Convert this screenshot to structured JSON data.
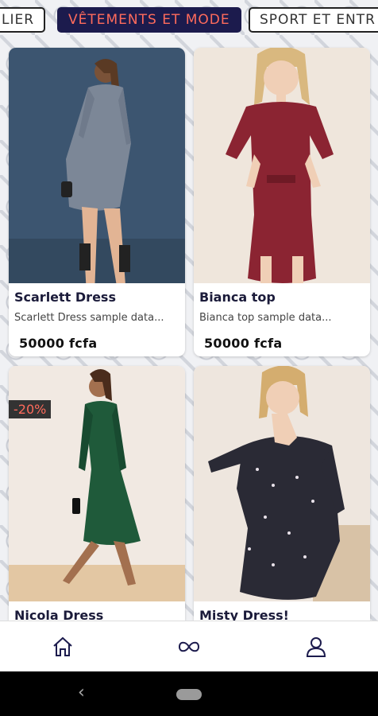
{
  "categories": [
    {
      "label": "LIER",
      "active": false
    },
    {
      "label": "VÊTEMENTS ET MODE",
      "active": true
    },
    {
      "label": "SPORT ET ENTR",
      "active": false
    }
  ],
  "products": [
    {
      "name": "Scarlett Dress",
      "description": "Scarlett Dress sample data...",
      "price": "50000 fcfa"
    },
    {
      "name": "Bianca top",
      "description": "Bianca top sample data...",
      "price": "50000 fcfa"
    },
    {
      "name": "Nicola Dress",
      "discount": "-20%"
    },
    {
      "name": "Misty Dress!"
    }
  ],
  "nav": {
    "items": [
      "home-icon",
      "infinity-icon",
      "user-icon"
    ]
  },
  "colors": {
    "accent": "#ff6b5c",
    "navy": "#1c1b4d"
  }
}
